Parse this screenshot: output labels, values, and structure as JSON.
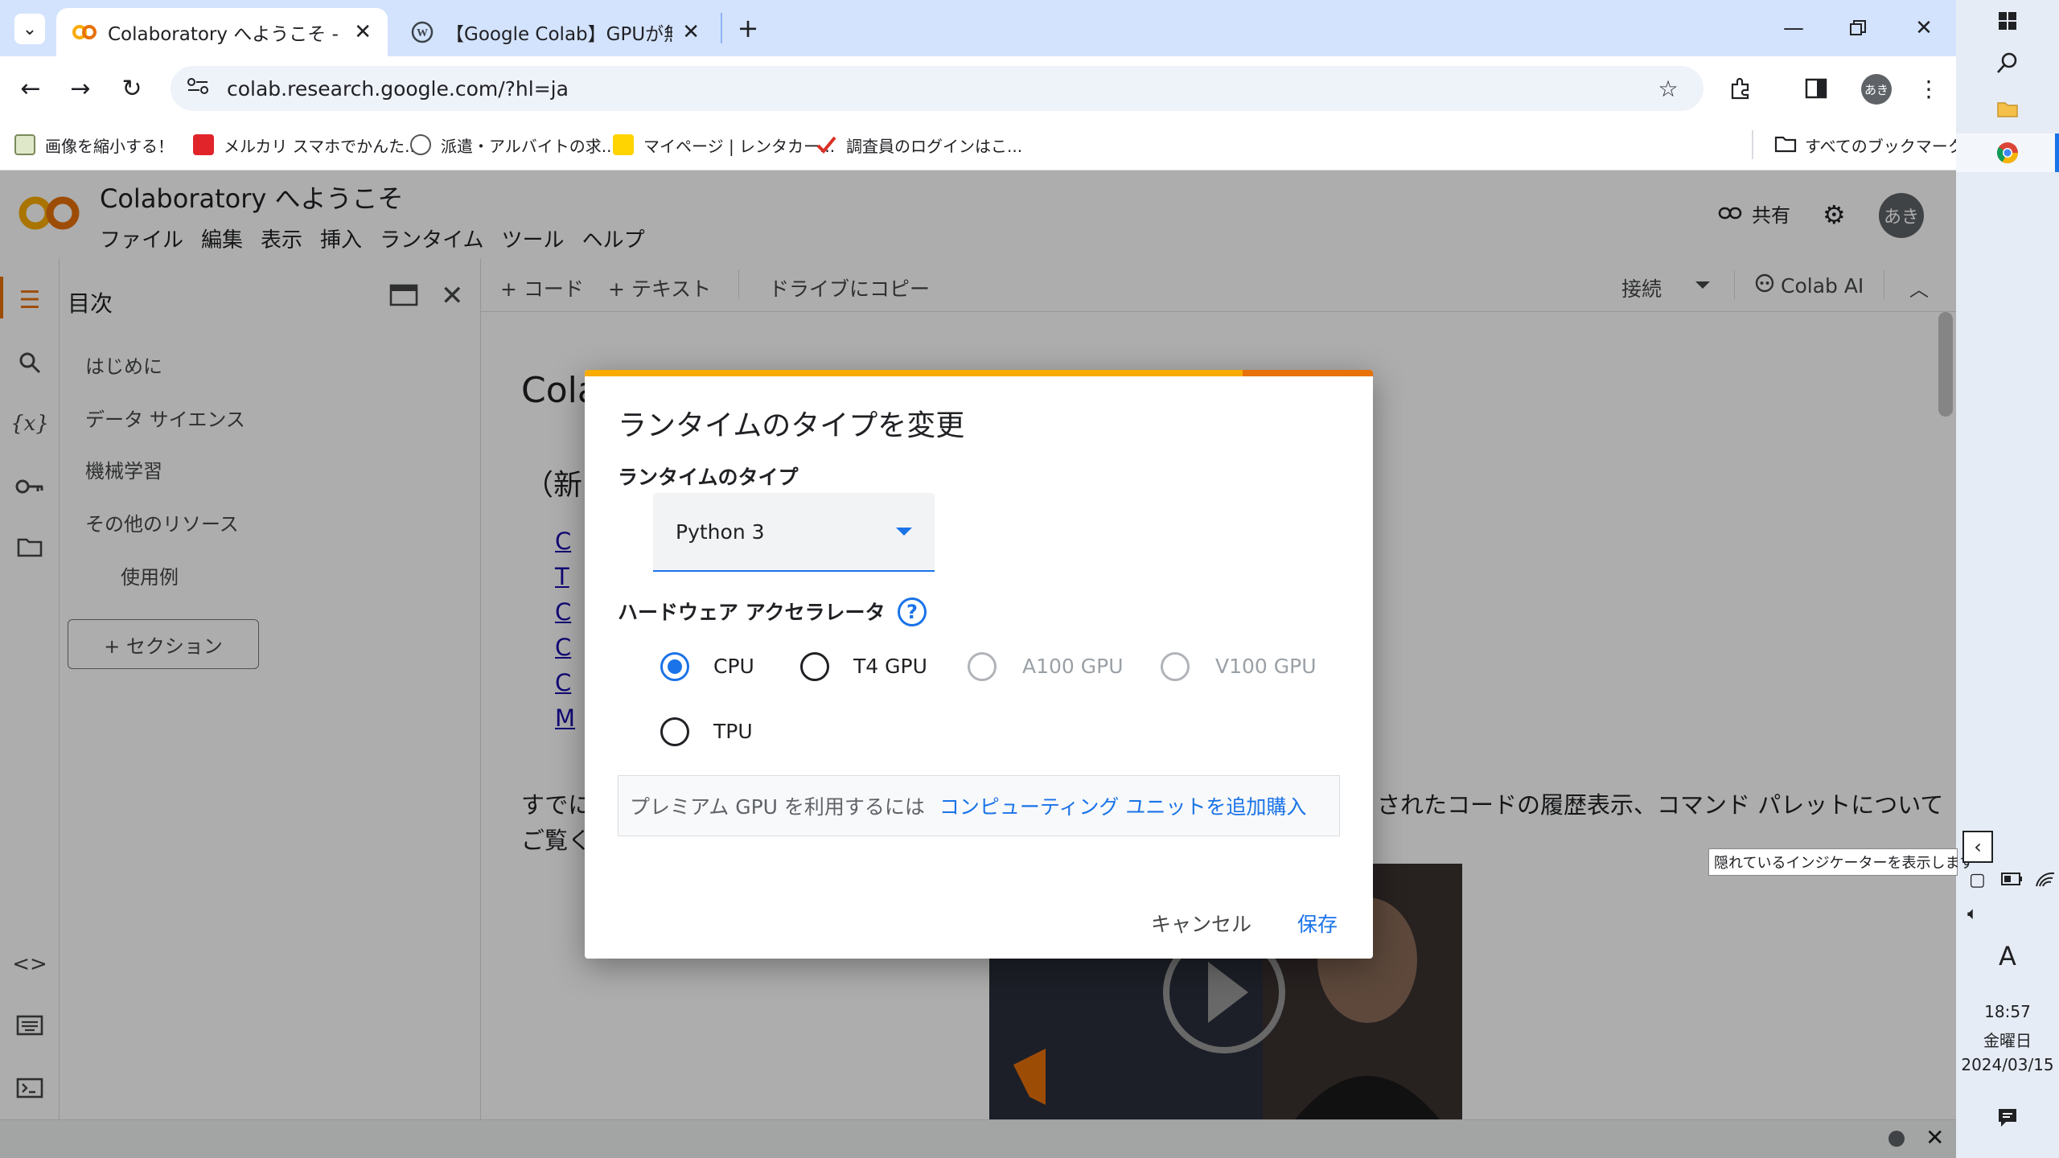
{
  "browser": {
    "tabs": [
      {
        "title": "Colaboratory へようこそ - Colabo",
        "close": "✕"
      },
      {
        "title": "【Google Colab】GPUが無料で使",
        "close": "✕"
      }
    ],
    "new_tab": "+",
    "url": "colab.research.google.com/?hl=ja",
    "profile": "あき",
    "bookmarks": [
      "画像を縮小する！",
      "メルカリ スマホでかんた...",
      "派遣・アルバイトの求...",
      "マイページ | レンタカー...",
      "調査員のログインはこ..."
    ],
    "all_bookmarks": "すべてのブックマーク",
    "colors": {
      "tabstrip": "#d3e3fd",
      "accent": "#1a73e8"
    }
  },
  "colab": {
    "title": "Colaboratory へようこそ",
    "menu": [
      "ファイル",
      "編集",
      "表示",
      "挿入",
      "ランタイム",
      "ツール",
      "ヘルプ"
    ],
    "share": "共有",
    "avatar": "あき",
    "toolbar": {
      "add_code": "+ コード",
      "add_text": "+ テキスト",
      "copy_drive": "ドライブにコピー",
      "connect": "接続",
      "colab_ai": "Colab AI"
    },
    "toc": {
      "title": "目次",
      "items": [
        "はじめに",
        "データ サイエンス",
        "機械学習",
        "その他のリソース"
      ],
      "subitem": "使用例",
      "section_button": "+ セクション"
    },
    "notebook": {
      "heading_partial": "Cola",
      "paren_partial": "（新",
      "list_letters": [
        "C",
        "T",
        "C",
        "C",
        "C",
        "M"
      ],
      "para_left": "すでに",
      "para_right": "されたコードの履歴表示、コマンド パレットについて",
      "para_line2": "ご覧く"
    }
  },
  "dialog": {
    "title": "ランタイムのタイプを変更",
    "runtime_label": "ランタイムのタイプ",
    "runtime_value": "Python 3",
    "accel_label": "ハードウェア アクセラレータ",
    "help": "?",
    "options": [
      {
        "label": "CPU",
        "state": "selected"
      },
      {
        "label": "T4 GPU",
        "state": "enabled"
      },
      {
        "label": "A100 GPU",
        "state": "disabled"
      },
      {
        "label": "V100 GPU",
        "state": "disabled"
      },
      {
        "label": "TPU",
        "state": "enabled"
      }
    ],
    "notice_text": "プレミアム GPU を利用するには",
    "notice_link": "コンピューティング ユニットを追加購入",
    "cancel": "キャンセル",
    "save": "保存"
  },
  "taskbar": {
    "tooltip": "隠れているインジケーターを表示します",
    "ime": "A",
    "time": "18:57",
    "weekday": "金曜日",
    "date": "2024/03/15"
  }
}
